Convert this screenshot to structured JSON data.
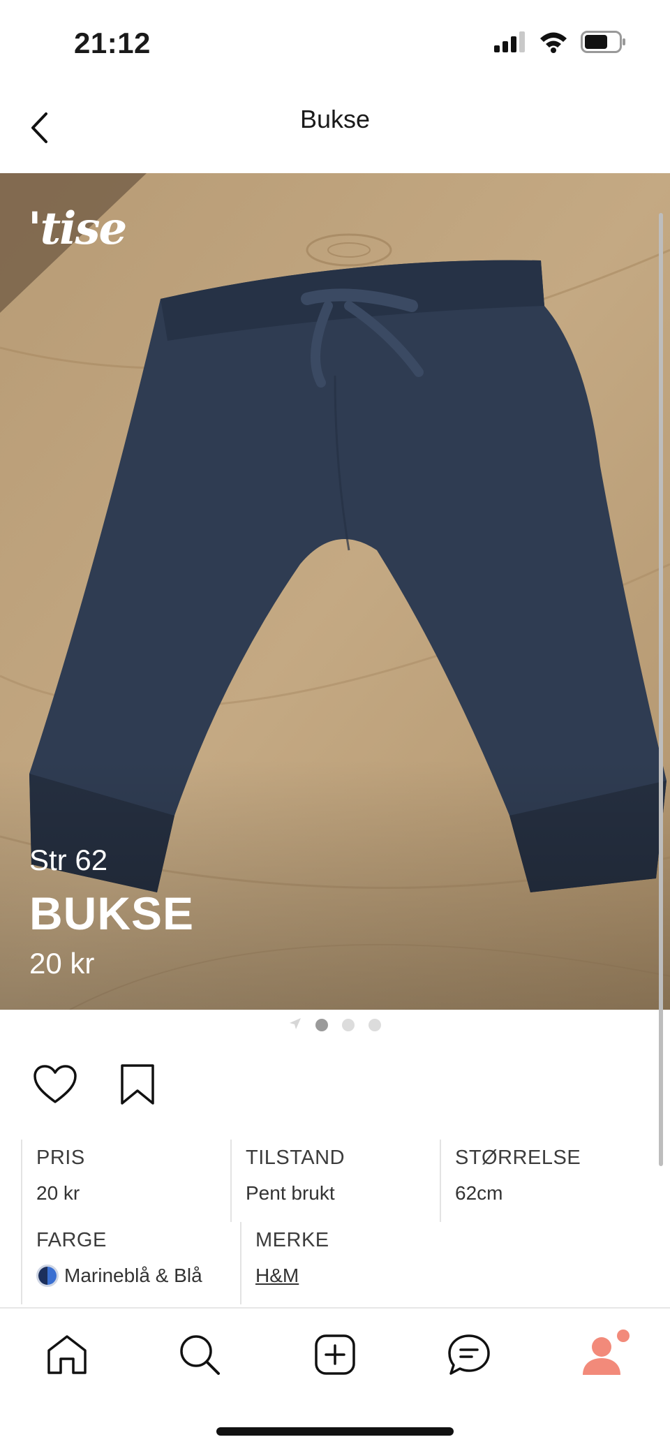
{
  "status_bar": {
    "time": "21:12",
    "icons": [
      "signal-icon",
      "wifi-icon",
      "battery-icon"
    ]
  },
  "header": {
    "title": "Bukse",
    "back_icon": "chevron-left-icon"
  },
  "hero": {
    "logo": "'tise",
    "size_text": "Str 62",
    "title": "BUKSE",
    "price": "20 kr",
    "pager": {
      "count": 3,
      "active_index": 0,
      "leading_icon": "location-arrow-icon"
    }
  },
  "actions": {
    "like_icon": "heart-icon",
    "save_icon": "bookmark-icon"
  },
  "details": [
    {
      "label": "PRIS",
      "value": "20 kr"
    },
    {
      "label": "TILSTAND",
      "value": "Pent brukt"
    },
    {
      "label": "STØRRELSE",
      "value": "62cm"
    },
    {
      "label": "FARGE",
      "value": "Marineblå & Blå",
      "swatch_colors": [
        "#1c2f5c",
        "#3a6fd1"
      ]
    },
    {
      "label": "MERKE",
      "value": "H&M",
      "is_link": true
    }
  ],
  "bottom_nav": {
    "items": [
      "home-icon",
      "search-icon",
      "add-listing-icon",
      "messages-icon",
      "profile-icon"
    ],
    "profile_color": "#f28a7a"
  },
  "colors": {
    "accent": "#f28a7a",
    "text": "#1a1a1a",
    "divider": "#e3e3e3"
  }
}
